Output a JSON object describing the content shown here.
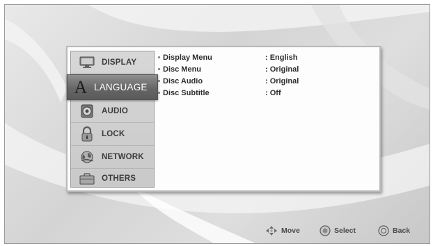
{
  "sidebar": {
    "items": [
      {
        "label": "DISPLAY",
        "icon": "monitor-icon"
      },
      {
        "label": "LANGUAGE",
        "icon": "language-icon",
        "icon_glyph": "A",
        "selected": true
      },
      {
        "label": "AUDIO",
        "icon": "speaker-icon"
      },
      {
        "label": "LOCK",
        "icon": "padlock-icon"
      },
      {
        "label": "NETWORK",
        "icon": "globe-network-icon"
      },
      {
        "label": "OTHERS",
        "icon": "toolbox-icon"
      }
    ]
  },
  "settings": [
    {
      "label": "Display Menu",
      "value": ": English"
    },
    {
      "label": "Disc Menu",
      "value": ": Original"
    },
    {
      "label": "Disc Audio",
      "value": ": Original"
    },
    {
      "label": "Disc Subtitle",
      "value": ": Off"
    }
  ],
  "footer": {
    "move": "Move",
    "select": "Select",
    "back": "Back"
  },
  "colors": {
    "selected_bg": "#666666",
    "panel_bg": "#fdfdfd",
    "sidebar_bg": "#d0d0d0"
  }
}
